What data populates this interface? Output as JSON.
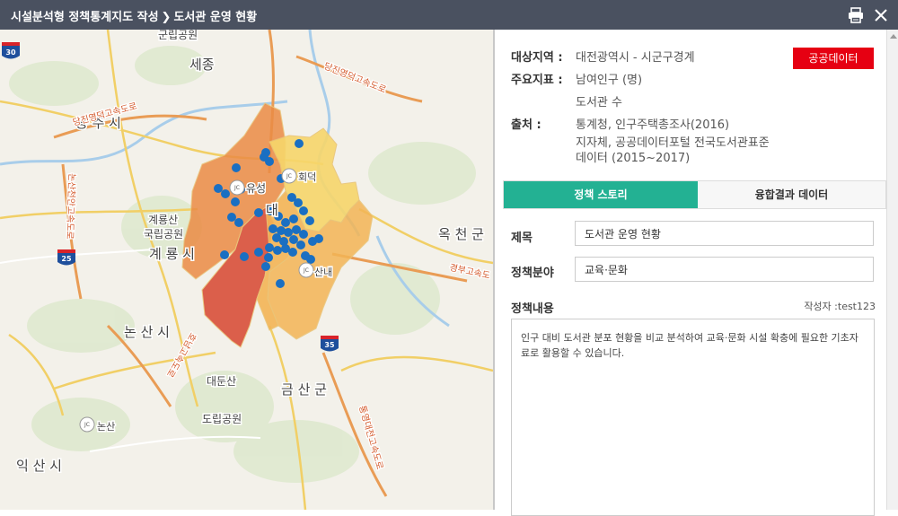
{
  "window": {
    "breadcrumb_parent": "시설분석형 정책통계지도 작성",
    "breadcrumb_current": "도서관 운영 현황"
  },
  "info": {
    "region_label": "대상지역 :",
    "region_value": "대전광역시 - 시군구경계",
    "indicator_label": "주요지표 :",
    "indicator_1": "남여인구 (명)",
    "indicator_2": "도서관 수",
    "source_label": "출처 :",
    "source_1": "통계청, 인구주택총조사(2016)",
    "source_2": "지자체, 공공데이터포털 전국도서관표준",
    "source_3": "데이터 (2015~2017)",
    "public_data_button": "공공데이터"
  },
  "tabs": [
    {
      "label": "정책 스토리",
      "active": true
    },
    {
      "label": "융합결과 데이터",
      "active": false
    }
  ],
  "form": {
    "title_label": "제목",
    "title_value": "도서관 운영 현황",
    "field_label": "정책분야",
    "field_value": "교육·문화",
    "content_label": "정책내용",
    "author": "작성자 :test123",
    "content_text": "인구 대비 도서관 분포 현황을 비교 분석하여 교육·문화 시설 확충에 필요한 기초자료로 활용할 수 있습니다."
  },
  "map": {
    "labels": {
      "sejong": "세종",
      "gunrip": "군립공원",
      "gongju": "공 주 시",
      "gyeryong_park_1": "계룡산",
      "gyeryong_park_2": "국립공원",
      "gyeryong": "계 룡 시",
      "nonsan": "논 산 시",
      "geumsan": "금 산 군",
      "okcheon": "옥 천 군",
      "daedunsan_1": "대둔산",
      "daedunsan_2": "도립공원",
      "iksan": "익 산 시",
      "yuseong": "유성",
      "hoedeok": "회덕",
      "sannae": "산내",
      "nonsan_jc": "논산",
      "dae": "대",
      "hw_dangjin_yeongdeok_1": "당진영덕고속도로",
      "hw_dangjin_yeongdeok_2": "당진영덕고속도로",
      "hw_nonsan_cheonan": "논산천안고속도로",
      "hw_honam": "호남고속도로",
      "hw_gyeongbu": "경부고속도",
      "hw_tongyeong": "통영대전고속도로",
      "route_30": "30",
      "route_25": "25",
      "route_35": "35"
    },
    "colors": {
      "dark_red": "#d9503a",
      "orange": "#eb8c45",
      "light_orange": "#f3b556",
      "yellow": "#f7d66b",
      "point": "#1a6fc2"
    }
  }
}
